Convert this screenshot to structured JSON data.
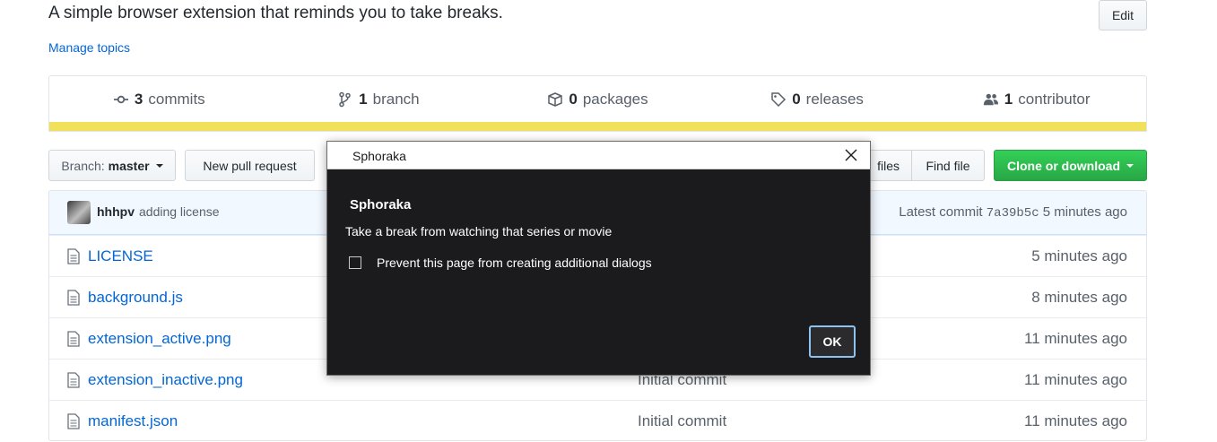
{
  "repo": {
    "description": "A simple browser extension that reminds you to take breaks.",
    "edit_label": "Edit",
    "manage_topics": "Manage topics"
  },
  "summary": {
    "commits": {
      "count": "3",
      "label": "commits",
      "icon": "commit-icon"
    },
    "branches": {
      "count": "1",
      "label": "branch",
      "icon": "branch-icon"
    },
    "packages": {
      "count": "0",
      "label": "packages",
      "icon": "package-icon"
    },
    "releases": {
      "count": "0",
      "label": "releases",
      "icon": "tag-icon"
    },
    "contributors": {
      "count": "1",
      "label": "contributor",
      "icon": "people-icon"
    },
    "language_bar_color": "#f1e05a"
  },
  "toolbar": {
    "branch_label": "Branch:",
    "branch_value": "master",
    "new_pull_request": "New pull request",
    "upload_files_partial": "files",
    "find_file": "Find file",
    "clone_or_download": "Clone or download"
  },
  "latest_commit": {
    "author": "hhhpv",
    "message": "adding license",
    "prefix": "Latest commit",
    "sha": "7a39b5c",
    "age": "5 minutes ago"
  },
  "files": [
    {
      "name": "LICENSE",
      "message": "",
      "age": "5 minutes ago"
    },
    {
      "name": "background.js",
      "message": "",
      "age": "8 minutes ago"
    },
    {
      "name": "extension_active.png",
      "message": "",
      "age": "11 minutes ago"
    },
    {
      "name": "extension_inactive.png",
      "message": "Initial commit",
      "age": "11 minutes ago"
    },
    {
      "name": "manifest.json",
      "message": "Initial commit",
      "age": "11 minutes ago"
    }
  ],
  "dialog": {
    "title": "Sphoraka",
    "heading": "Sphoraka",
    "message": "Take a break from watching that series or movie",
    "checkbox_label": "Prevent this page from creating additional dialogs",
    "checkbox_checked": false,
    "ok_label": "OK"
  },
  "colors": {
    "link": "#0366d6",
    "clone_button": "#28a745",
    "dialog_background": "#1b1b1e",
    "ok_focus_ring": "#8ec2ef"
  }
}
